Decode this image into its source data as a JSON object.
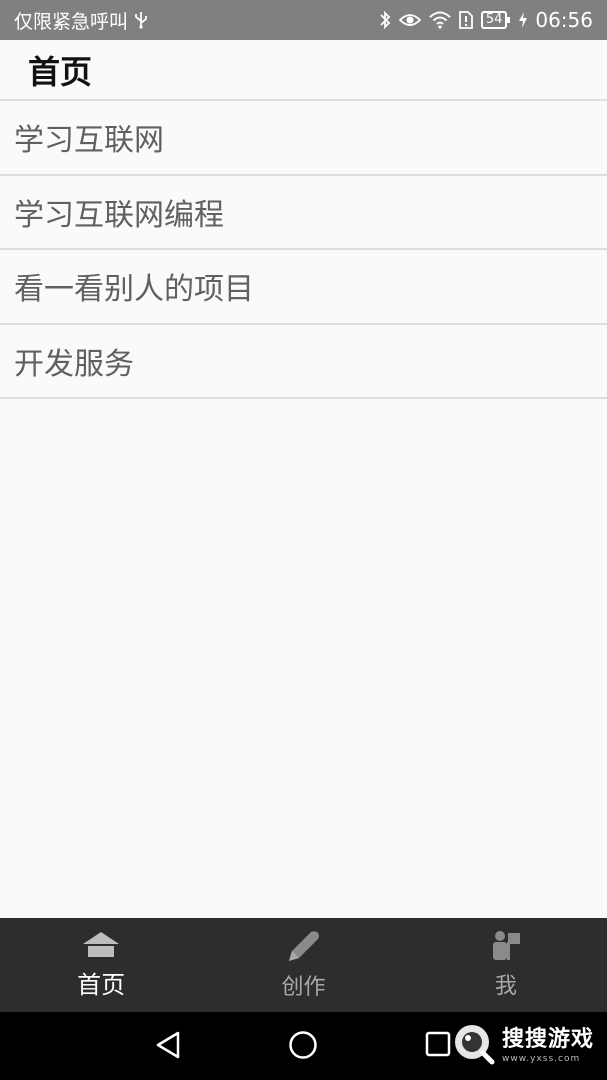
{
  "status_bar": {
    "carrier_text": "仅限紧急呼叫",
    "battery_level": "54",
    "time": "06:56"
  },
  "header": {
    "title": "首页"
  },
  "list": {
    "items": [
      {
        "label": "学习互联网"
      },
      {
        "label": "学习互联网编程"
      },
      {
        "label": "看一看别人的项目"
      },
      {
        "label": "开发服务"
      }
    ]
  },
  "tab_bar": {
    "tabs": [
      {
        "label": "首页",
        "icon": "home-icon",
        "active": true
      },
      {
        "label": "创作",
        "icon": "pencil-icon",
        "active": false
      },
      {
        "label": "我",
        "icon": "person-icon",
        "active": false
      }
    ]
  },
  "nav_bar": {
    "buttons": [
      "back-icon",
      "home-circle-icon",
      "recents-icon"
    ]
  },
  "watermark": {
    "main": "搜搜游戏",
    "sub": "www.yxss.com"
  },
  "colors": {
    "status_bar_bg": "#808080",
    "tab_bar_bg": "#2d2d2d",
    "list_text": "#606060",
    "background": "#fafafa"
  }
}
